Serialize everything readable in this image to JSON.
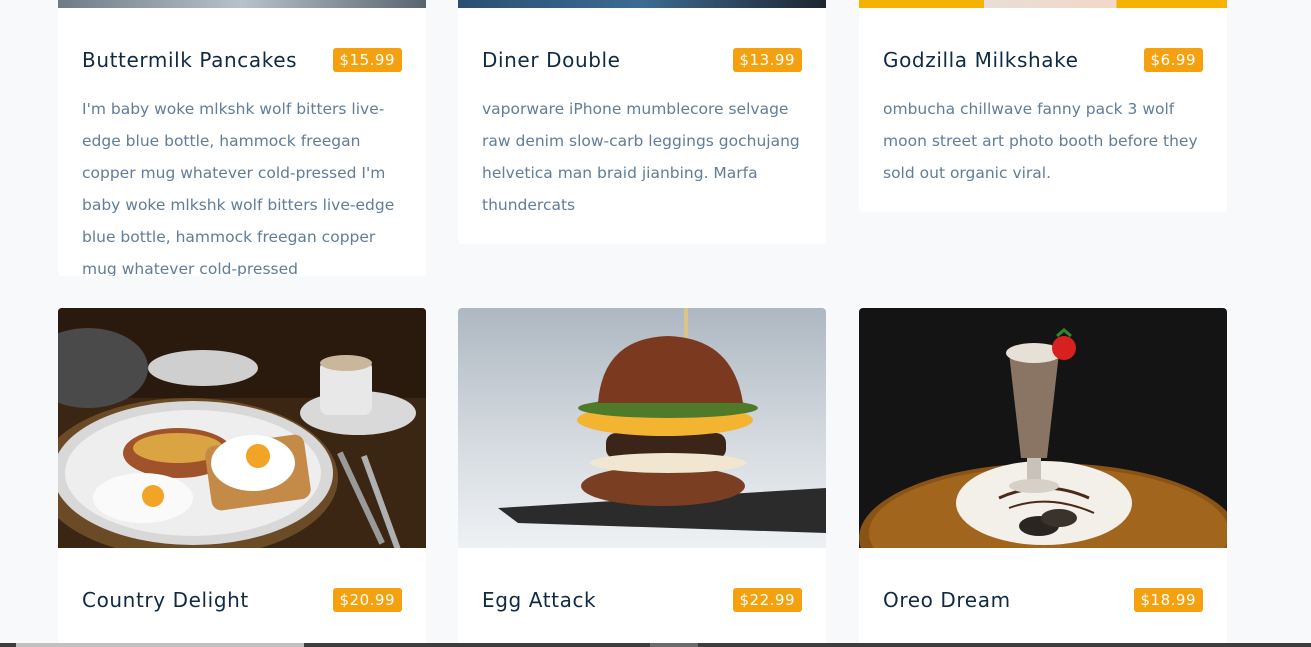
{
  "menu": {
    "items": [
      {
        "title": "Buttermilk Pancakes",
        "price": "$15.99",
        "desc": "I'm baby woke mlkshk wolf bitters live-edge blue bottle, hammock freegan copper mug whatever cold-pressed I'm baby woke mlkshk wolf bitters live-edge blue bottle, hammock freegan copper mug whatever cold-pressed"
      },
      {
        "title": "Diner Double",
        "price": "$13.99",
        "desc": "vaporware iPhone mumblecore selvage raw denim slow-carb leggings gochujang helvetica man braid jianbing. Marfa thundercats"
      },
      {
        "title": "Godzilla Milkshake",
        "price": "$6.99",
        "desc": "ombucha chillwave fanny pack 3 wolf moon street art photo booth before they sold out organic viral."
      },
      {
        "title": "Country Delight",
        "price": "$20.99",
        "desc": ""
      },
      {
        "title": "Egg Attack",
        "price": "$22.99",
        "desc": ""
      },
      {
        "title": "Oreo Dream",
        "price": "$18.99",
        "desc": ""
      }
    ]
  },
  "colors": {
    "accent": "#f5a10f",
    "title": "#102a43",
    "text": "#617d98",
    "background": "#f8f9fb"
  }
}
